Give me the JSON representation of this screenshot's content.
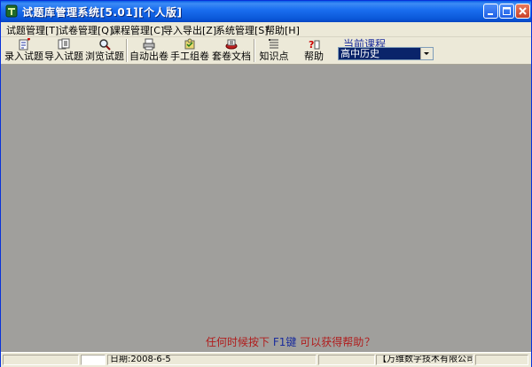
{
  "window": {
    "title": "试题库管理系统[5.01][个人版]"
  },
  "menu": [
    {
      "label": "试题管理[T]"
    },
    {
      "label": "试卷管理[Q]"
    },
    {
      "label": "课程管理[C]"
    },
    {
      "label": "导入导出[Z]"
    },
    {
      "label": "系统管理[S]"
    },
    {
      "label": "帮助[H]"
    }
  ],
  "toolbar": {
    "enter_question": "录入试题",
    "import_question": "导入试题",
    "browse_question": "浏览试题",
    "auto_paper": "自动出卷",
    "manual_paper": "手工组卷",
    "paper_docs": "套卷文档",
    "knowledge_points": "知识点",
    "help": "帮助"
  },
  "course": {
    "label": "当前课程",
    "selected": "高中历史"
  },
  "hint": {
    "before": "任何时候按下 ",
    "key": "F1键",
    "after": " 可以获得帮助",
    "mark": "？"
  },
  "status": {
    "date": "日期:2008-6-5",
    "company": "【万维数字技术有限公司】"
  },
  "colors": {
    "titlebar": "#0a57d8",
    "client_background": "#a09f9c",
    "hint_text": "#b01c1c",
    "course_label": "#1a2c9c"
  }
}
